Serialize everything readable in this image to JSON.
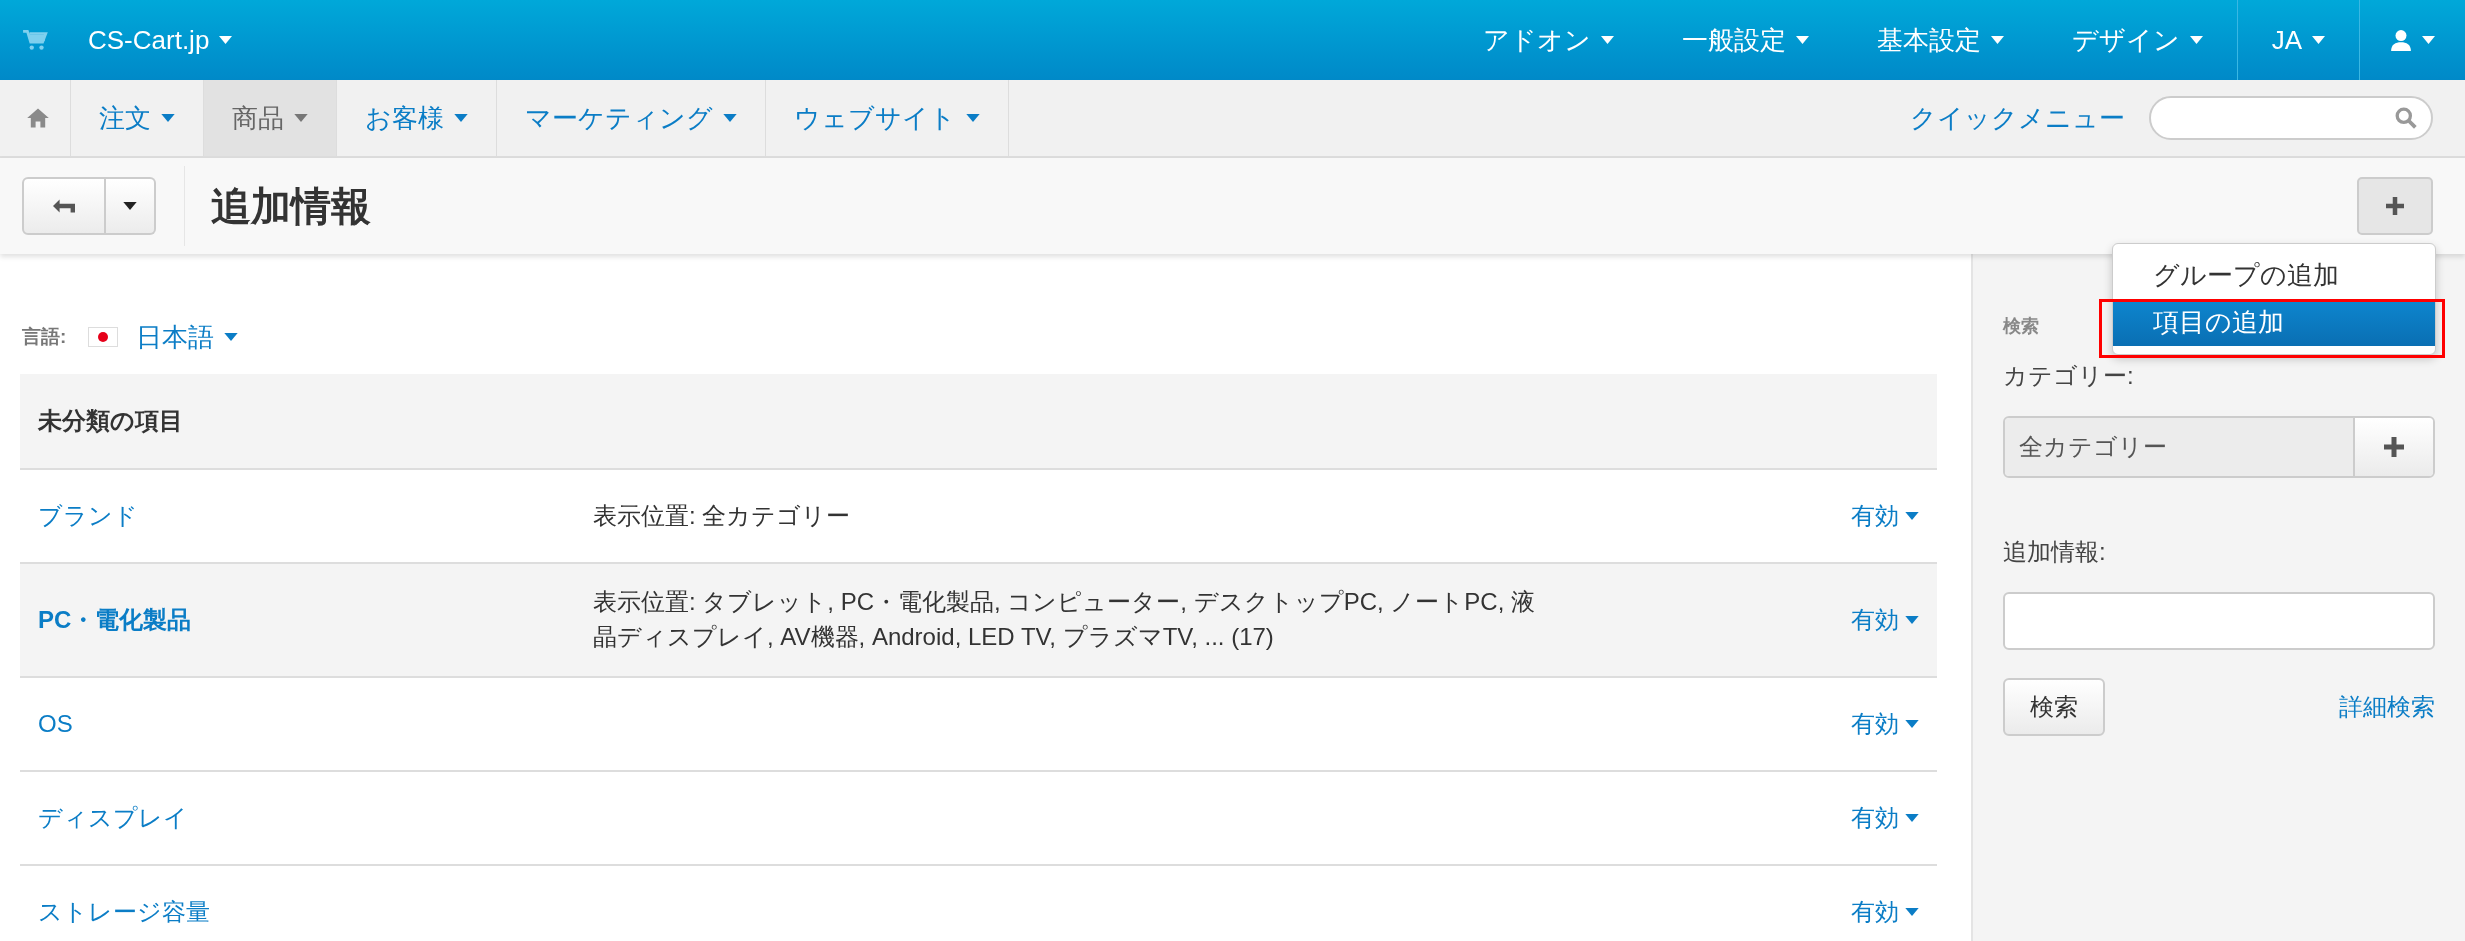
{
  "top_bar": {
    "store": "CS-Cart.jp",
    "menus": [
      {
        "label": "アドオン"
      },
      {
        "label": "一般設定"
      },
      {
        "label": "基本設定"
      },
      {
        "label": "デザイン"
      }
    ],
    "language": "JA"
  },
  "nav": {
    "items": [
      {
        "label": "注文",
        "selected": false
      },
      {
        "label": "商品",
        "selected": true
      },
      {
        "label": "お客様",
        "selected": false
      },
      {
        "label": "マーケティング",
        "selected": false
      },
      {
        "label": "ウェブサイト",
        "selected": false
      }
    ],
    "quick_menu": "クイックメニュー"
  },
  "header": {
    "title": "追加情報"
  },
  "add_menu": {
    "items": [
      {
        "label": "グループの追加",
        "selected": false,
        "annotated": false
      },
      {
        "label": "項目の追加",
        "selected": true,
        "annotated": true
      }
    ]
  },
  "language": {
    "label": "言語:",
    "value": "日本語"
  },
  "group": {
    "title": "未分類の項目",
    "rows": [
      {
        "name": "ブランド",
        "highlighted": false,
        "display": "表示位置: 全カテゴリー",
        "status": "有効"
      },
      {
        "name": "PC・電化製品",
        "highlighted": true,
        "display": "表示位置: タブレット, PC・電化製品, コンピューター, デスクトップPC, ノートPC, 液晶ディスプレイ, AV機器, Android, LED TV, プラズマTV, ... (17)",
        "status": "有効"
      },
      {
        "name": "OS",
        "highlighted": false,
        "display": "",
        "status": "有効"
      },
      {
        "name": "ディスプレイ",
        "highlighted": false,
        "display": "",
        "status": "有効"
      },
      {
        "name": "ストレージ容量",
        "highlighted": false,
        "display": "",
        "status": "有効"
      }
    ]
  },
  "sidebar": {
    "title": "検索",
    "category_label": "カテゴリー:",
    "category_value": "全カテゴリー",
    "feature_label": "追加情報:",
    "search_button": "検索",
    "advanced_link": "詳細検索"
  }
}
